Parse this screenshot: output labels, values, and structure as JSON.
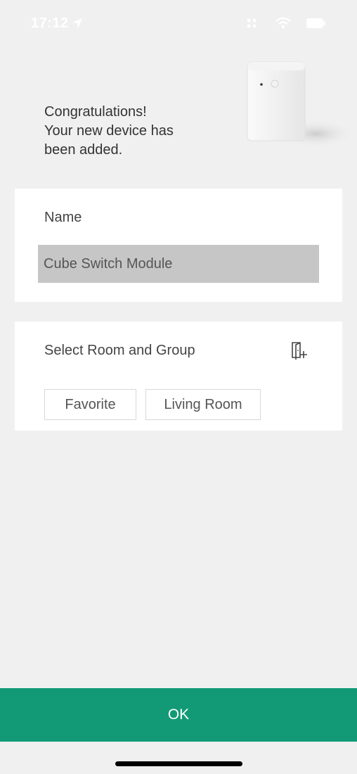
{
  "status_bar": {
    "time": "17:12",
    "location_icon": "location-arrow-icon",
    "icons": [
      "signal-icon",
      "wifi-icon",
      "battery-icon"
    ]
  },
  "hero": {
    "message": "Congratulations!\nYour new device has\nbeen added.",
    "device_image": "cube-switch-module-image"
  },
  "name_card": {
    "label": "Name",
    "value": "Cube Switch Module"
  },
  "room_card": {
    "label": "Select Room and Group",
    "add_icon": "add-room-icon",
    "chips": [
      {
        "label": "Favorite"
      },
      {
        "label": "Living Room"
      }
    ]
  },
  "footer": {
    "ok_label": "OK"
  },
  "colors": {
    "accent": "#129a76",
    "background": "#f0f0f0",
    "card": "#ffffff",
    "input": "#c6c6c6"
  }
}
